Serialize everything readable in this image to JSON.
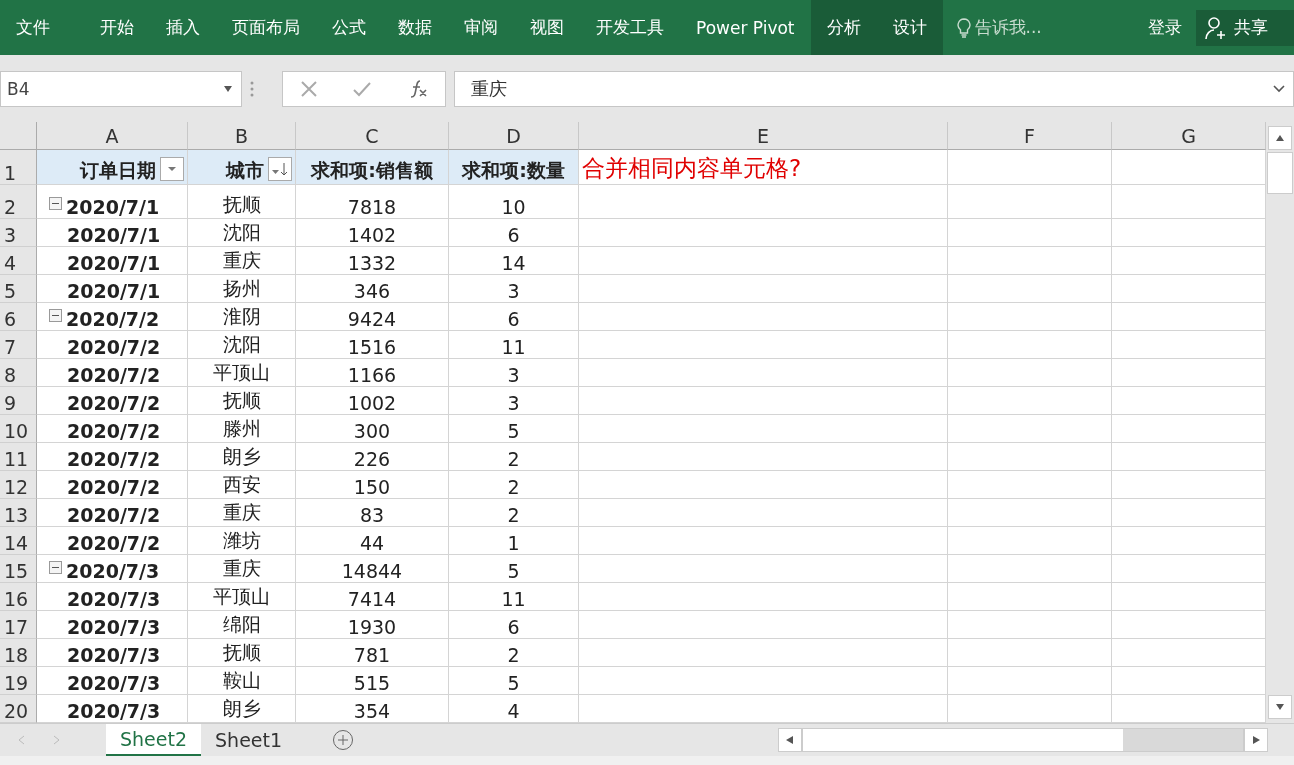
{
  "ribbon": {
    "tabs": [
      {
        "label": "文件",
        "kind": "file"
      },
      {
        "label": "开始",
        "kind": "tab"
      },
      {
        "label": "插入",
        "kind": "tab"
      },
      {
        "label": "页面布局",
        "kind": "tab"
      },
      {
        "label": "公式",
        "kind": "tab"
      },
      {
        "label": "数据",
        "kind": "tab"
      },
      {
        "label": "审阅",
        "kind": "tab"
      },
      {
        "label": "视图",
        "kind": "tab"
      },
      {
        "label": "开发工具",
        "kind": "tab"
      },
      {
        "label": "Power Pivot",
        "kind": "tab"
      },
      {
        "label": "分析",
        "kind": "contextual"
      },
      {
        "label": "设计",
        "kind": "contextual"
      }
    ],
    "search": {
      "placeholder": "告诉我..."
    },
    "sign_in": "登录",
    "share": "共享"
  },
  "formula_bar": {
    "name_box": "B4",
    "formula": "重庆"
  },
  "sheet": {
    "columns": [
      "A",
      "B",
      "C",
      "D",
      "E",
      "F",
      "G"
    ],
    "header_row": {
      "number": "1",
      "cells": [
        {
          "label": "订单日期",
          "filter_button": true,
          "sorted": false
        },
        {
          "label": "城市",
          "filter_button": true,
          "sorted": true
        },
        {
          "label": "求和项:销售额"
        },
        {
          "label": "求和项:数量"
        }
      ],
      "note": "合并相同内容单元格?"
    },
    "rows": [
      {
        "number": "2",
        "kind": "group",
        "expanded": true,
        "date": "2020/7/1",
        "city": "抚顺",
        "sales": "7818",
        "qty": "10"
      },
      {
        "number": "3",
        "kind": "item",
        "date": "2020/7/1",
        "city": "沈阳",
        "sales": "1402",
        "qty": "6"
      },
      {
        "number": "4",
        "kind": "item",
        "date": "2020/7/1",
        "city": "重庆",
        "sales": "1332",
        "qty": "14"
      },
      {
        "number": "5",
        "kind": "item",
        "date": "2020/7/1",
        "city": "扬州",
        "sales": "346",
        "qty": "3"
      },
      {
        "number": "6",
        "kind": "group",
        "expanded": true,
        "date": "2020/7/2",
        "city": "淮阴",
        "sales": "9424",
        "qty": "6"
      },
      {
        "number": "7",
        "kind": "item",
        "date": "2020/7/2",
        "city": "沈阳",
        "sales": "1516",
        "qty": "11"
      },
      {
        "number": "8",
        "kind": "item",
        "date": "2020/7/2",
        "city": "平顶山",
        "sales": "1166",
        "qty": "3"
      },
      {
        "number": "9",
        "kind": "item",
        "date": "2020/7/2",
        "city": "抚顺",
        "sales": "1002",
        "qty": "3"
      },
      {
        "number": "10",
        "kind": "item",
        "date": "2020/7/2",
        "city": "滕州",
        "sales": "300",
        "qty": "5"
      },
      {
        "number": "11",
        "kind": "item",
        "date": "2020/7/2",
        "city": "朗乡",
        "sales": "226",
        "qty": "2"
      },
      {
        "number": "12",
        "kind": "item",
        "date": "2020/7/2",
        "city": "西安",
        "sales": "150",
        "qty": "2"
      },
      {
        "number": "13",
        "kind": "item",
        "date": "2020/7/2",
        "city": "重庆",
        "sales": "83",
        "qty": "2"
      },
      {
        "number": "14",
        "kind": "item",
        "date": "2020/7/2",
        "city": "潍坊",
        "sales": "44",
        "qty": "1"
      },
      {
        "number": "15",
        "kind": "group",
        "expanded": true,
        "date": "2020/7/3",
        "city": "重庆",
        "sales": "14844",
        "qty": "5"
      },
      {
        "number": "16",
        "kind": "item",
        "date": "2020/7/3",
        "city": "平顶山",
        "sales": "7414",
        "qty": "11"
      },
      {
        "number": "17",
        "kind": "item",
        "date": "2020/7/3",
        "city": "绵阳",
        "sales": "1930",
        "qty": "6"
      },
      {
        "number": "18",
        "kind": "item",
        "date": "2020/7/3",
        "city": "抚顺",
        "sales": "781",
        "qty": "2"
      },
      {
        "number": "19",
        "kind": "item",
        "date": "2020/7/3",
        "city": "鞍山",
        "sales": "515",
        "qty": "5"
      },
      {
        "number": "20",
        "kind": "item",
        "date": "2020/7/3",
        "city": "朗乡",
        "sales": "354",
        "qty": "4"
      }
    ]
  },
  "sheet_tabs": [
    {
      "label": "Sheet2",
      "selected": true
    },
    {
      "label": "Sheet1",
      "selected": false
    }
  ]
}
